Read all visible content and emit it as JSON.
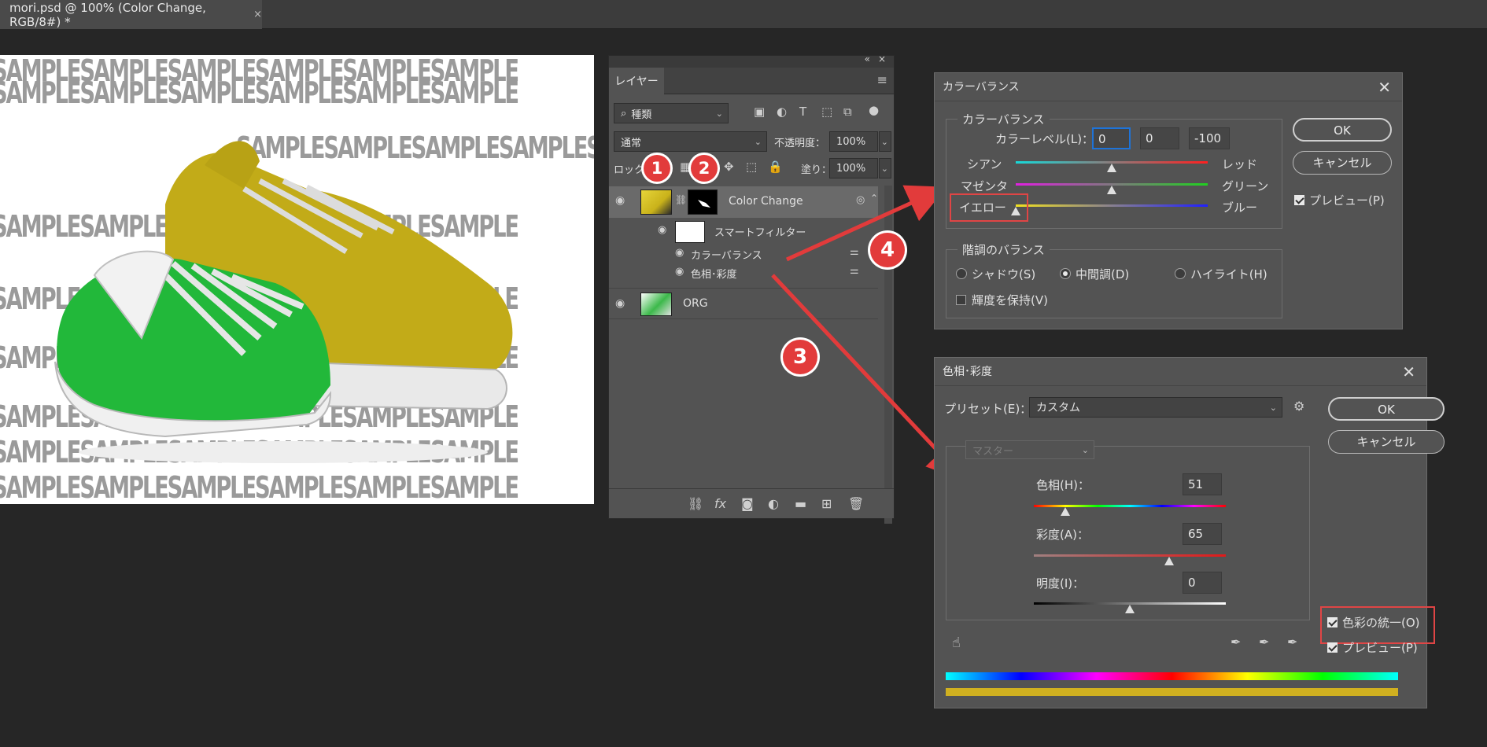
{
  "document_tab": {
    "title": "mori.psd @ 100% (Color Change, RGB/8#) *",
    "close": "×"
  },
  "canvas": {
    "watermark_text": "SAMPLESAMPLESAMPLESAMPLESAMPLESAMPLE"
  },
  "layers_panel": {
    "collapse": "«",
    "close": "×",
    "tab": "レイヤー",
    "filter_kind": "種類",
    "blend_mode": "通常",
    "opacity_label": "不透明度：",
    "opacity_value": "100%",
    "lock_label": "ロック：",
    "fill_label": "塗り：",
    "fill_value": "100%",
    "layers": [
      {
        "name": "Color Change"
      },
      {
        "name": "スマートフィルター"
      },
      {
        "name": "カラーバランス"
      },
      {
        "name": "色相･彩度"
      },
      {
        "name": "ORG"
      }
    ]
  },
  "annotations": {
    "b1": "1",
    "b2": "2",
    "b3": "3",
    "b4": "4"
  },
  "color_balance": {
    "title": "カラーバランス",
    "group_label": "カラーバランス",
    "level_label": "カラーレベル(L)：",
    "levels": [
      "0",
      "0",
      "-100"
    ],
    "sliders": [
      {
        "left": "シアン",
        "right": "レッド",
        "value": 0
      },
      {
        "left": "マゼンタ",
        "right": "グリーン",
        "value": 0
      },
      {
        "left": "イエロー",
        "right": "ブルー",
        "value": -100
      }
    ],
    "tone_group_label": "階調のバランス",
    "tones": [
      "シャドウ(S)",
      "中間調(D)",
      "ハイライト(H)"
    ],
    "selected_tone": "中間調(D)",
    "preserve_luminosity": "輝度を保持(V)",
    "ok": "OK",
    "cancel": "キャンセル",
    "preview": "プレビュー(P)"
  },
  "hue_saturation": {
    "title": "色相･彩度",
    "preset_label": "プリセット(E)：",
    "preset_value": "カスタム",
    "channel": "マスター",
    "hue_label": "色相(H)：",
    "hue_value": "51",
    "saturation_label": "彩度(A)：",
    "saturation_value": "65",
    "lightness_label": "明度(I)：",
    "lightness_value": "0",
    "colorize": "色彩の統一(O)",
    "preview": "プレビュー(P)",
    "ok": "OK",
    "cancel": "キャンセル"
  },
  "colors": {
    "accent_red": "#e23b3b",
    "shoe_yellow": "#c9b21a",
    "shoe_green": "#22b83a"
  }
}
